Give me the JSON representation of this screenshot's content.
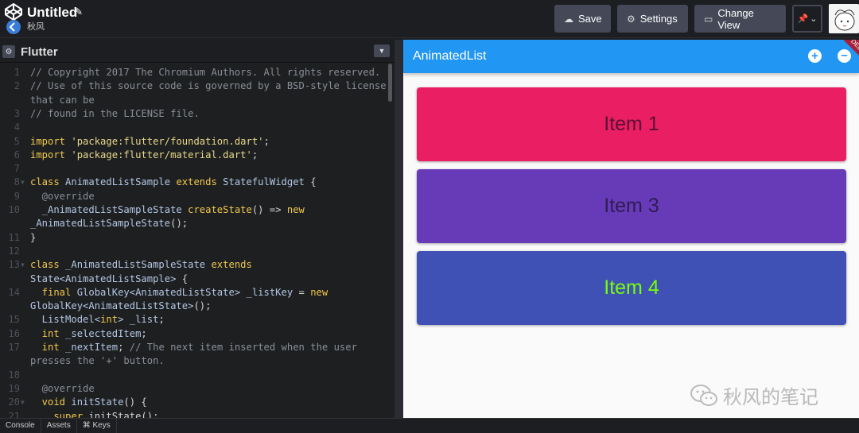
{
  "header": {
    "title": "Untitled",
    "user": "秋风",
    "buttons": {
      "save": "Save",
      "settings": "Settings",
      "change_view": "Change View"
    }
  },
  "editor": {
    "title": "Flutter",
    "lines": [
      {
        "n": "1",
        "fold": false,
        "segs": [
          {
            "t": "// Copyright 2017 The Chromium Authors. All rights reserved.",
            "c": "c-com"
          }
        ]
      },
      {
        "n": "2",
        "fold": false,
        "segs": [
          {
            "t": "// Use of this source code is governed by a BSD-style license",
            "c": "c-com"
          }
        ]
      },
      {
        "n": "",
        "fold": false,
        "segs": [
          {
            "t": "that can be",
            "c": "c-com"
          }
        ]
      },
      {
        "n": "3",
        "fold": false,
        "segs": [
          {
            "t": "// found in the LICENSE file.",
            "c": "c-com"
          }
        ]
      },
      {
        "n": "4",
        "fold": false,
        "segs": []
      },
      {
        "n": "5",
        "fold": false,
        "segs": [
          {
            "t": "import ",
            "c": "c-kw"
          },
          {
            "t": "'package:flutter/foundation.dart'",
            "c": "c-str"
          },
          {
            "t": ";",
            "c": ""
          }
        ]
      },
      {
        "n": "6",
        "fold": false,
        "segs": [
          {
            "t": "import ",
            "c": "c-kw"
          },
          {
            "t": "'package:flutter/material.dart'",
            "c": "c-str"
          },
          {
            "t": ";",
            "c": ""
          }
        ]
      },
      {
        "n": "7",
        "fold": false,
        "segs": []
      },
      {
        "n": "8",
        "fold": true,
        "segs": [
          {
            "t": "class ",
            "c": "c-kw"
          },
          {
            "t": "AnimatedListSample ",
            "c": "c-id"
          },
          {
            "t": "extends ",
            "c": "c-kw"
          },
          {
            "t": "StatefulWidget",
            "c": "c-id"
          },
          {
            "t": " {",
            "c": ""
          }
        ]
      },
      {
        "n": "9",
        "fold": false,
        "segs": [
          {
            "t": "  @override",
            "c": "c-com"
          }
        ]
      },
      {
        "n": "10",
        "fold": false,
        "segs": [
          {
            "t": "  _AnimatedListSampleState ",
            "c": "c-id"
          },
          {
            "t": "createState",
            "c": "c-kw"
          },
          {
            "t": "() => ",
            "c": ""
          },
          {
            "t": "new",
            "c": "c-kw"
          }
        ]
      },
      {
        "n": "",
        "fold": false,
        "segs": [
          {
            "t": "_AnimatedListSampleState",
            "c": "c-id"
          },
          {
            "t": "();",
            "c": ""
          }
        ]
      },
      {
        "n": "11",
        "fold": false,
        "segs": [
          {
            "t": "}",
            "c": ""
          }
        ]
      },
      {
        "n": "12",
        "fold": false,
        "segs": []
      },
      {
        "n": "13",
        "fold": true,
        "segs": [
          {
            "t": "class ",
            "c": "c-kw"
          },
          {
            "t": "_AnimatedListSampleState ",
            "c": "c-id"
          },
          {
            "t": "extends",
            "c": "c-kw"
          }
        ]
      },
      {
        "n": "",
        "fold": false,
        "segs": [
          {
            "t": "State<AnimatedListSample>",
            "c": "c-id"
          },
          {
            "t": " {",
            "c": ""
          }
        ]
      },
      {
        "n": "14",
        "fold": false,
        "segs": [
          {
            "t": "  final ",
            "c": "c-kw"
          },
          {
            "t": "GlobalKey<AnimatedListState> _listKey",
            "c": "c-id"
          },
          {
            "t": " = ",
            "c": ""
          },
          {
            "t": "new",
            "c": "c-kw"
          }
        ]
      },
      {
        "n": "",
        "fold": false,
        "segs": [
          {
            "t": "GlobalKey<AnimatedListState>",
            "c": "c-id"
          },
          {
            "t": "();",
            "c": ""
          }
        ]
      },
      {
        "n": "15",
        "fold": false,
        "segs": [
          {
            "t": "  ListModel<",
            "c": "c-id"
          },
          {
            "t": "int",
            "c": "c-kw"
          },
          {
            "t": "> _list",
            "c": "c-id"
          },
          {
            "t": ";",
            "c": ""
          }
        ]
      },
      {
        "n": "16",
        "fold": false,
        "segs": [
          {
            "t": "  int ",
            "c": "c-kw"
          },
          {
            "t": "_selectedItem",
            "c": "c-id"
          },
          {
            "t": ";",
            "c": ""
          }
        ]
      },
      {
        "n": "17",
        "fold": false,
        "segs": [
          {
            "t": "  int ",
            "c": "c-kw"
          },
          {
            "t": "_nextItem",
            "c": "c-id"
          },
          {
            "t": "; ",
            "c": ""
          },
          {
            "t": "// The next item inserted when the user",
            "c": "c-com"
          }
        ]
      },
      {
        "n": "",
        "fold": false,
        "segs": [
          {
            "t": "presses the '+' button.",
            "c": "c-com"
          }
        ]
      },
      {
        "n": "18",
        "fold": false,
        "segs": []
      },
      {
        "n": "19",
        "fold": false,
        "segs": [
          {
            "t": "  @override",
            "c": "c-com"
          }
        ]
      },
      {
        "n": "20",
        "fold": true,
        "segs": [
          {
            "t": "  void ",
            "c": "c-kw"
          },
          {
            "t": "initState",
            "c": "c-id"
          },
          {
            "t": "() {",
            "c": ""
          }
        ]
      },
      {
        "n": "21",
        "fold": false,
        "segs": [
          {
            "t": "    super",
            "c": "c-kw"
          },
          {
            "t": ".initState();",
            "c": ""
          }
        ]
      }
    ]
  },
  "preview": {
    "appbar_title": "AnimatedList",
    "debug_label": "DEBUG",
    "items": [
      {
        "label": "Item 1",
        "bg": "#e91e63",
        "fg": "#5a1032"
      },
      {
        "label": "Item 3",
        "bg": "#673ab7",
        "fg": "#2e1d52"
      },
      {
        "label": "Item 4",
        "bg": "#3f51b5",
        "fg": "#76ff03"
      }
    ],
    "watermark": "秋风的笔记"
  },
  "bottom_tabs": [
    "Console",
    "Assets",
    "⌘ Keys"
  ],
  "icons": {
    "save": "cloud-icon",
    "settings": "gear-icon",
    "change_view": "layout-icon",
    "pin": "pin-icon",
    "add": "add-circle-icon",
    "remove": "remove-circle-icon"
  }
}
